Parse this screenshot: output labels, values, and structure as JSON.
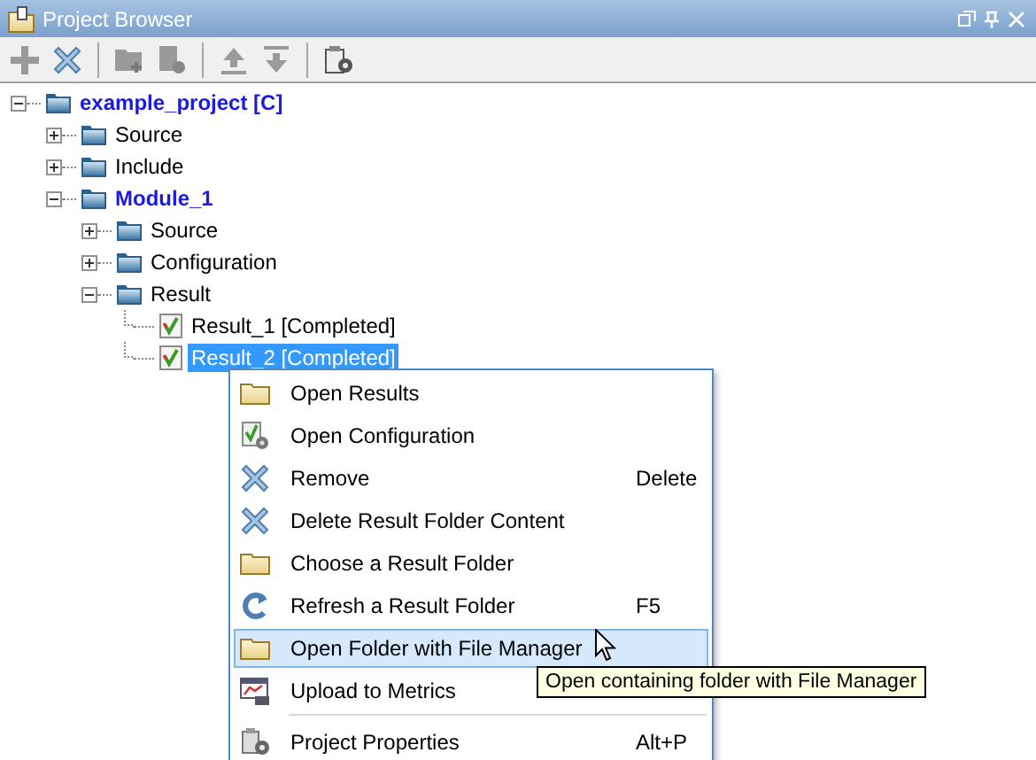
{
  "window": {
    "title": "Project Browser"
  },
  "toolbar": [
    {
      "kind": "add",
      "disabled": true
    },
    {
      "kind": "remove",
      "disabled": false
    },
    {
      "kind": "separator"
    },
    {
      "kind": "new-folder",
      "disabled": true
    },
    {
      "kind": "config",
      "disabled": true
    },
    {
      "kind": "separator"
    },
    {
      "kind": "move-up",
      "disabled": true
    },
    {
      "kind": "move-down",
      "disabled": true
    },
    {
      "kind": "separator"
    },
    {
      "kind": "properties",
      "disabled": false
    }
  ],
  "tree": [
    {
      "label": "example_project [C]",
      "kind": "project",
      "expanded": true,
      "selected": false,
      "children": [
        {
          "label": "Source",
          "kind": "folder",
          "expanded": false,
          "selected": false
        },
        {
          "label": "Include",
          "kind": "folder",
          "expanded": false,
          "selected": false
        },
        {
          "label": "Module_1",
          "kind": "module",
          "expanded": true,
          "selected": false,
          "children": [
            {
              "label": "Source",
              "kind": "folder",
              "expanded": false,
              "selected": false
            },
            {
              "label": "Configuration",
              "kind": "folder",
              "expanded": false,
              "selected": false
            },
            {
              "label": "Result",
              "kind": "folder",
              "expanded": true,
              "selected": false,
              "children": [
                {
                  "label": "Result_1 [Completed]",
                  "kind": "result",
                  "selected": false
                },
                {
                  "label": "Result_2 [Completed]",
                  "kind": "result",
                  "selected": true
                }
              ]
            }
          ]
        }
      ]
    }
  ],
  "context_menu": [
    {
      "kind": "folder",
      "label": "Open Results",
      "selected": false
    },
    {
      "kind": "config",
      "label": "Open Configuration",
      "selected": false
    },
    {
      "kind": "remove",
      "label": "Remove",
      "shortcut": "Delete",
      "selected": false
    },
    {
      "kind": "remove",
      "label": "Delete Result Folder Content",
      "selected": false
    },
    {
      "kind": "folder",
      "label": "Choose a Result Folder",
      "selected": false
    },
    {
      "kind": "refresh",
      "label": "Refresh a Result Folder",
      "shortcut": "F5",
      "selected": false
    },
    {
      "kind": "folder",
      "label": "Open Folder with File Manager",
      "selected": true
    },
    {
      "kind": "metrics",
      "label": "Upload to Metrics",
      "selected": false
    },
    {
      "kind": "separator"
    },
    {
      "kind": "properties",
      "label": "Project Properties",
      "shortcut": "Alt+P",
      "selected": false
    }
  ],
  "tooltip": {
    "text": "Open containing folder with File Manager"
  }
}
